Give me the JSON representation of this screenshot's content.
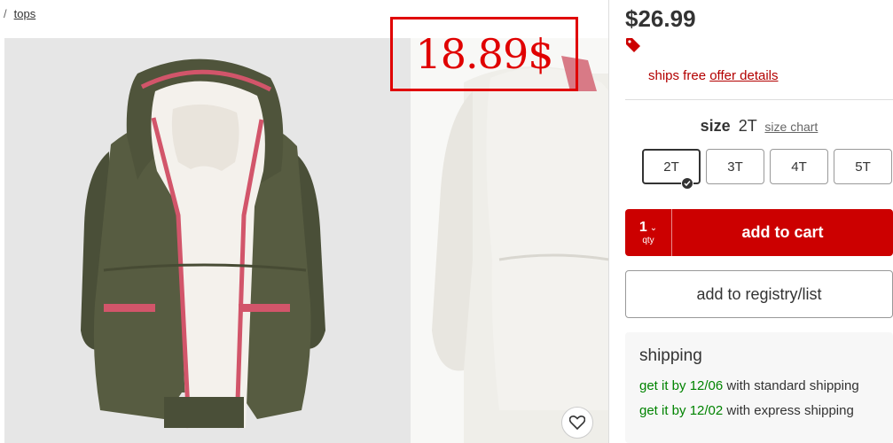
{
  "breadcrumb": {
    "separator": "/",
    "link": "tops"
  },
  "annotation": {
    "text": "18.89$",
    "color": "#e00000"
  },
  "product": {
    "price": "$26.99",
    "shipping_promo": {
      "text": "ships free",
      "link": "offer details"
    },
    "size": {
      "label": "size",
      "selected": "2T",
      "chart_link": "size chart",
      "options": [
        "2T",
        "3T",
        "4T",
        "5T"
      ]
    },
    "cart": {
      "qty": "1",
      "qty_label": "qty",
      "add_label": "add to cart"
    },
    "registry_label": "add to registry/list",
    "shipping": {
      "title": "shipping",
      "standard": {
        "date": "get it by 12/06",
        "method": "with standard shipping"
      },
      "express": {
        "date": "get it by 12/02",
        "method": "with express shipping"
      }
    }
  },
  "colors": {
    "accent_red": "#cc0000",
    "promo_red": "#b30000",
    "ship_green": "#008300"
  },
  "icons": [
    "tag-icon",
    "heart-icon",
    "chevron-down-icon",
    "checkmark-icon"
  ]
}
